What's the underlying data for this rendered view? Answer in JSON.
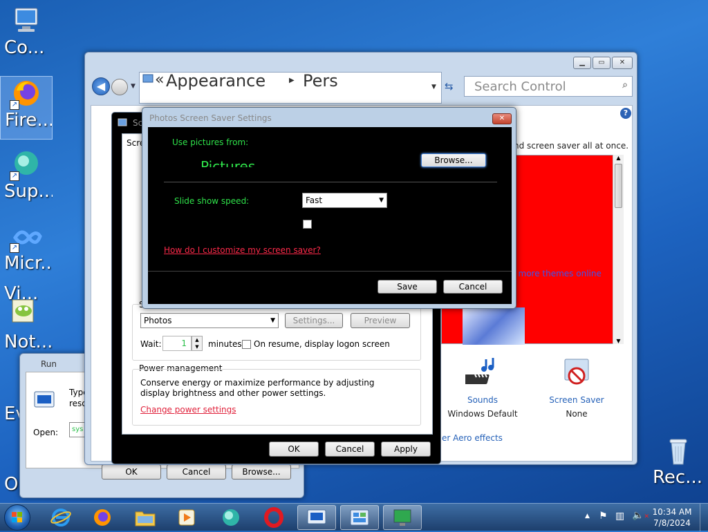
{
  "desktop_icons": [
    {
      "label": "Co...",
      "icon": "computer-icon"
    },
    {
      "label": "Fire...",
      "icon": "firefox-icon"
    },
    {
      "label": "Sup...",
      "icon": "support-icon"
    },
    {
      "label": "Micr...",
      "icon": "visual-studio-icon"
    },
    {
      "label": "Vi...",
      "icon": "notepad-plus-icon"
    },
    {
      "label": "Not...",
      "icon": "notepad-icon"
    },
    {
      "label": "Ev...",
      "icon": "person-icon"
    },
    {
      "label": "O...",
      "icon": "opera-icon"
    },
    {
      "label": "Rec...",
      "icon": "recycle-bin-icon"
    }
  ],
  "control_panel": {
    "breadcrumb_prefix": "«",
    "breadcrumb_1": "Appearance",
    "breadcrumb_2": "Pers",
    "search_placeholder": "Search Control",
    "theme_hint": "nd screen saver all at once.",
    "more_themes": "t more themes online",
    "sounds_label": "Sounds",
    "sounds_value": "Windows Default",
    "screensaver_label": "Screen Saver",
    "screensaver_value": "None",
    "aero_link": "er Aero effects",
    "help": "?"
  },
  "screensaver_dialog": {
    "title_abbr": "Sc",
    "tab_abbr": "Scre",
    "group_abbr": "S",
    "selected_saver": "Photos",
    "settings_button": "Settings...",
    "preview_button": "Preview",
    "wait_label": "Wait:",
    "wait_value": "1",
    "minutes_label": "minutes",
    "resume_label": "On resume, display logon screen",
    "power_title": "Power management",
    "power_desc": "Conserve energy or maximize performance by adjusting display brightness and other power settings.",
    "power_link": "Change power settings",
    "ok": "OK",
    "cancel": "Cancel",
    "apply": "Apply"
  },
  "photos_settings": {
    "title": "Photos Screen Saver Settings",
    "use_pictures_label": "Use pictures from:",
    "folder": "Pictures",
    "browse_button": "Browse...",
    "speed_label": "Slide show speed:",
    "speed_value": "Fast",
    "help_link": "How do I customize my screen saver?",
    "save_button": "Save",
    "cancel_button": "Cancel"
  },
  "run_dialog": {
    "title": "Run",
    "desc_1": "Type",
    "desc_2": "reso",
    "open_label": "Open:",
    "open_value": "sys",
    "ok": "OK",
    "cancel": "Cancel",
    "browse": "Browse..."
  },
  "taskbar": {
    "time": "10:34 AM",
    "date": "7/8/2024"
  }
}
